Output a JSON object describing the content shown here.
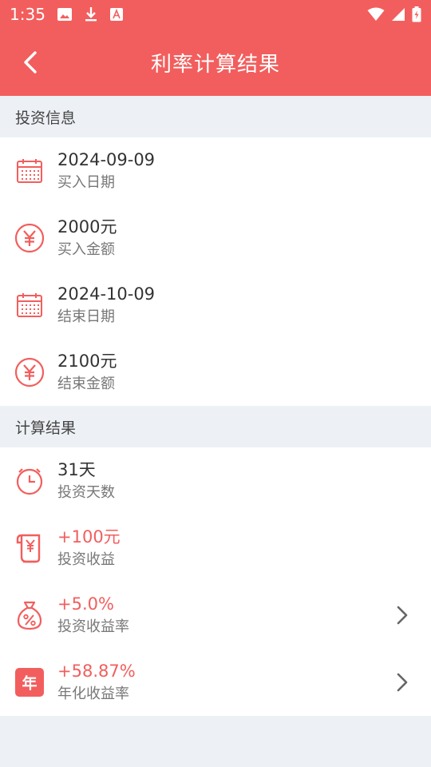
{
  "status_bar": {
    "time": "1:35"
  },
  "header": {
    "title": "利率计算结果"
  },
  "investment_info": {
    "section_title": "投资信息",
    "items": [
      {
        "icon": "calendar-icon",
        "value": "2024-09-09",
        "label": "买入日期"
      },
      {
        "icon": "yen-circle-icon",
        "value": "2000元",
        "label": "买入金额"
      },
      {
        "icon": "calendar-icon",
        "value": "2024-10-09",
        "label": "结束日期"
      },
      {
        "icon": "yen-circle-icon",
        "value": "2100元",
        "label": "结束金额"
      }
    ]
  },
  "result": {
    "section_title": "计算结果",
    "items": [
      {
        "icon": "clock-icon",
        "value": "31天",
        "label": "投资天数"
      },
      {
        "icon": "yen-receipt-icon",
        "value": "+100元",
        "label": "投资收益"
      },
      {
        "icon": "percent-bag-icon",
        "value": "+5.0%",
        "label": "投资收益率"
      },
      {
        "icon": "year-badge-icon",
        "value": "+58.87%",
        "label": "年化收益率",
        "badge_text": "年"
      }
    ]
  },
  "colors": {
    "accent": "#f25e5d",
    "background": "#edf1f5"
  }
}
